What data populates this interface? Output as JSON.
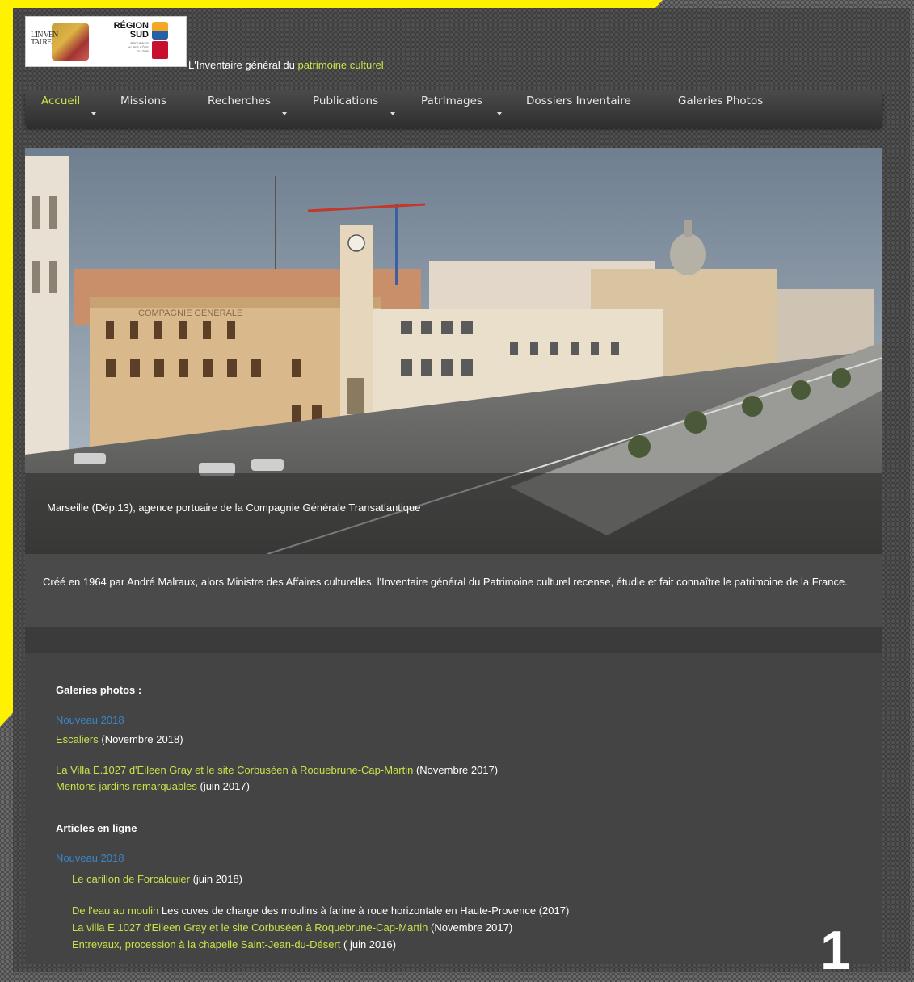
{
  "header": {
    "logo_left_text": "L'IN VEN TAI RE",
    "logo_region": "RÉGION SUD",
    "logo_region_sub": "PROVENCE ALPES CÔTE D'AZUR",
    "tagline_prefix": "L'Inventaire général du ",
    "tagline_accent": "patrimoine culturel"
  },
  "nav": {
    "items": [
      {
        "label": "Accueil",
        "has_caret": true,
        "active": true
      },
      {
        "label": "Missions",
        "has_caret": false,
        "active": false
      },
      {
        "label": "Recherches",
        "has_caret": true,
        "active": false
      },
      {
        "label": "Publications",
        "has_caret": true,
        "active": false
      },
      {
        "label": "PatrImages",
        "has_caret": true,
        "active": false
      },
      {
        "label": "Dossiers Inventaire",
        "has_caret": false,
        "active": false
      },
      {
        "label": "Galeries Photos",
        "has_caret": false,
        "active": false
      }
    ]
  },
  "hero": {
    "caption": "Marseille (Dép.13), agence portuaire de la Compagnie Générale Transatlantique",
    "building_sign": "COMPAGNIE GENERALE"
  },
  "intro": {
    "text": "Créé en 1964 par André Malraux, alors Ministre des Affaires culturelles, l'Inventaire général du Patrimoine culturel recense, étudie et fait connaître le patrimoine de la France."
  },
  "galleries": {
    "heading": "Galeries photos :",
    "new_label": "Nouveau 2018",
    "items": [
      {
        "link": "Escaliers",
        "suffix": " (Novembre 2018)"
      },
      {
        "link": "La Villa E.1027 d'Eileen Gray et le site Corbuséen à Roquebrune-Cap-Martin",
        "suffix": " (Novembre 2017)"
      },
      {
        "link": "Mentons jardins remarquables",
        "suffix": " (juin 2017)"
      }
    ]
  },
  "articles": {
    "heading": "Articles en ligne",
    "new_label": "Nouveau 2018",
    "items": [
      {
        "link": "Le carillon de Forcalquier",
        "suffix": " (juin 2018)"
      },
      {
        "link": "De l'eau au moulin",
        "suffix": " Les cuves de charge des moulins à farine à roue horizontale en Haute-Provence (2017)"
      },
      {
        "link": "La villa E.1027 d'Eileen Gray et le site Corbuséen à Roquebrune-Cap-Martin",
        "suffix": " (Novembre 2017)"
      },
      {
        "link": "Entrevaux, procession à la chapelle Saint-Jean-du-Désert",
        "suffix": " ( juin 2016)"
      }
    ]
  },
  "page_number": "1",
  "colors": {
    "accent_link": "#c6e34a",
    "new_label_blue": "#3a86c8",
    "corner_yellow": "#fff200"
  }
}
